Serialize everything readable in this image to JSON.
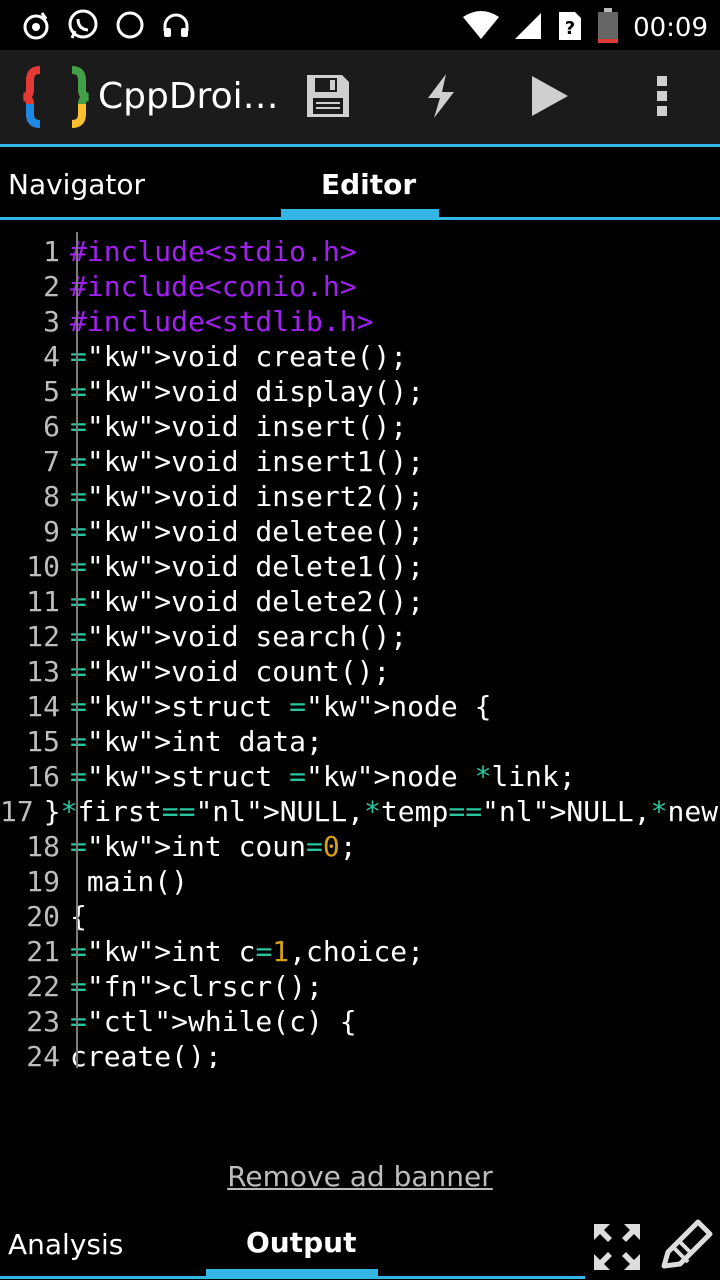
{
  "status_bar": {
    "time": "00:09",
    "icons": [
      "music-note-icon",
      "whatsapp-icon",
      "circle-icon",
      "headset-icon",
      "wifi-icon",
      "signal-icon",
      "sim-unknown-icon",
      "battery-icon"
    ]
  },
  "action_bar": {
    "title": "CppDroi…",
    "actions": [
      "save-icon",
      "flash-icon",
      "play-icon",
      "overflow-menu-icon"
    ]
  },
  "top_tabs": [
    {
      "label": "Navigator",
      "selected": false
    },
    {
      "label": "Editor",
      "selected": true
    }
  ],
  "editor": {
    "lines": [
      {
        "n": "1",
        "text": "#include<stdio.h>"
      },
      {
        "n": "2",
        "text": "#include<conio.h>"
      },
      {
        "n": "3",
        "text": "#include<stdlib.h>"
      },
      {
        "n": "4",
        "text": "void create();"
      },
      {
        "n": "5",
        "text": "void display();"
      },
      {
        "n": "6",
        "text": "void insert();"
      },
      {
        "n": "7",
        "text": "void insert1();"
      },
      {
        "n": "8",
        "text": "void insert2();"
      },
      {
        "n": "9",
        "text": "void deletee();"
      },
      {
        "n": "10",
        "text": "void delete1();"
      },
      {
        "n": "11",
        "text": "void delete2();"
      },
      {
        "n": "12",
        "text": "void search();"
      },
      {
        "n": "13",
        "text": "void count();"
      },
      {
        "n": "14",
        "text": "struct node {"
      },
      {
        "n": "15",
        "text": "int data;"
      },
      {
        "n": "16",
        "text": "struct node *link;"
      },
      {
        "n": "17",
        "text": "}*first=NULL,*temp=NULL,*newnode;"
      },
      {
        "n": "18",
        "text": "int coun=0;"
      },
      {
        "n": "19",
        "text": " main()"
      },
      {
        "n": "20",
        "text": "{"
      },
      {
        "n": "21",
        "text": "int c=1,choice;"
      },
      {
        "n": "22",
        "text": "clrscr();"
      },
      {
        "n": "23",
        "text": "while(c) {"
      },
      {
        "n": "24",
        "text": "create();"
      }
    ]
  },
  "ad": {
    "link": "Remove ad banner"
  },
  "bottom_tabs": [
    {
      "label": "Analysis",
      "selected": false
    },
    {
      "label": "Output",
      "selected": true
    }
  ],
  "bottom_actions": [
    "fullscreen-icon",
    "edit-icon"
  ],
  "colors": {
    "accent": "#33b5e5",
    "preprocessor": "#a020f0",
    "keyword": "#3d8fe0",
    "operator": "#27c5a0",
    "number": "#d4a017",
    "control": "#c8662a"
  }
}
